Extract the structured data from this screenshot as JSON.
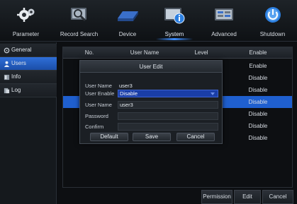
{
  "topnav": {
    "items": [
      {
        "label": "Parameter",
        "icon": "gears-icon"
      },
      {
        "label": "Record Search",
        "icon": "magnifier-icon"
      },
      {
        "label": "Device",
        "icon": "hard-drive-icon"
      },
      {
        "label": "System",
        "icon": "system-info-icon",
        "active": true
      },
      {
        "label": "Advanced",
        "icon": "advanced-settings-icon"
      },
      {
        "label": "Shutdown",
        "icon": "power-icon"
      }
    ]
  },
  "sidebar": {
    "items": [
      {
        "label": "General",
        "icon": "gear-icon"
      },
      {
        "label": "Users",
        "icon": "user-icon",
        "active": true
      },
      {
        "label": "Info",
        "icon": "info-icon"
      },
      {
        "label": "Log",
        "icon": "log-icon"
      }
    ]
  },
  "table": {
    "headers": {
      "no": "No.",
      "user_name": "User Name",
      "level": "Level",
      "enable": "Enable"
    },
    "rows": [
      {
        "enable": "Enable"
      },
      {
        "enable": "Disable"
      },
      {
        "enable": "Disable"
      },
      {
        "enable": "Disable",
        "selected": true
      },
      {
        "enable": "Disable"
      },
      {
        "enable": "Disable"
      },
      {
        "enable": "Disable"
      }
    ]
  },
  "bottom_buttons": {
    "permission": "Permission",
    "edit": "Edit",
    "cancel": "Cancel"
  },
  "dialog": {
    "title": "User Edit",
    "user_name_label": "User Name",
    "user_name_value": "user3",
    "user_enable_label": "User Enable",
    "user_enable_value": "Disable",
    "user_name2_label": "User Name",
    "user_name2_value": "user3",
    "password_label": "Password",
    "confirm_label": "Confirm",
    "default_label": "Default",
    "save_label": "Save",
    "cancel_label": "Cancel"
  },
  "colors": {
    "accent": "#1f5fcf",
    "background": "#0b0d10"
  }
}
